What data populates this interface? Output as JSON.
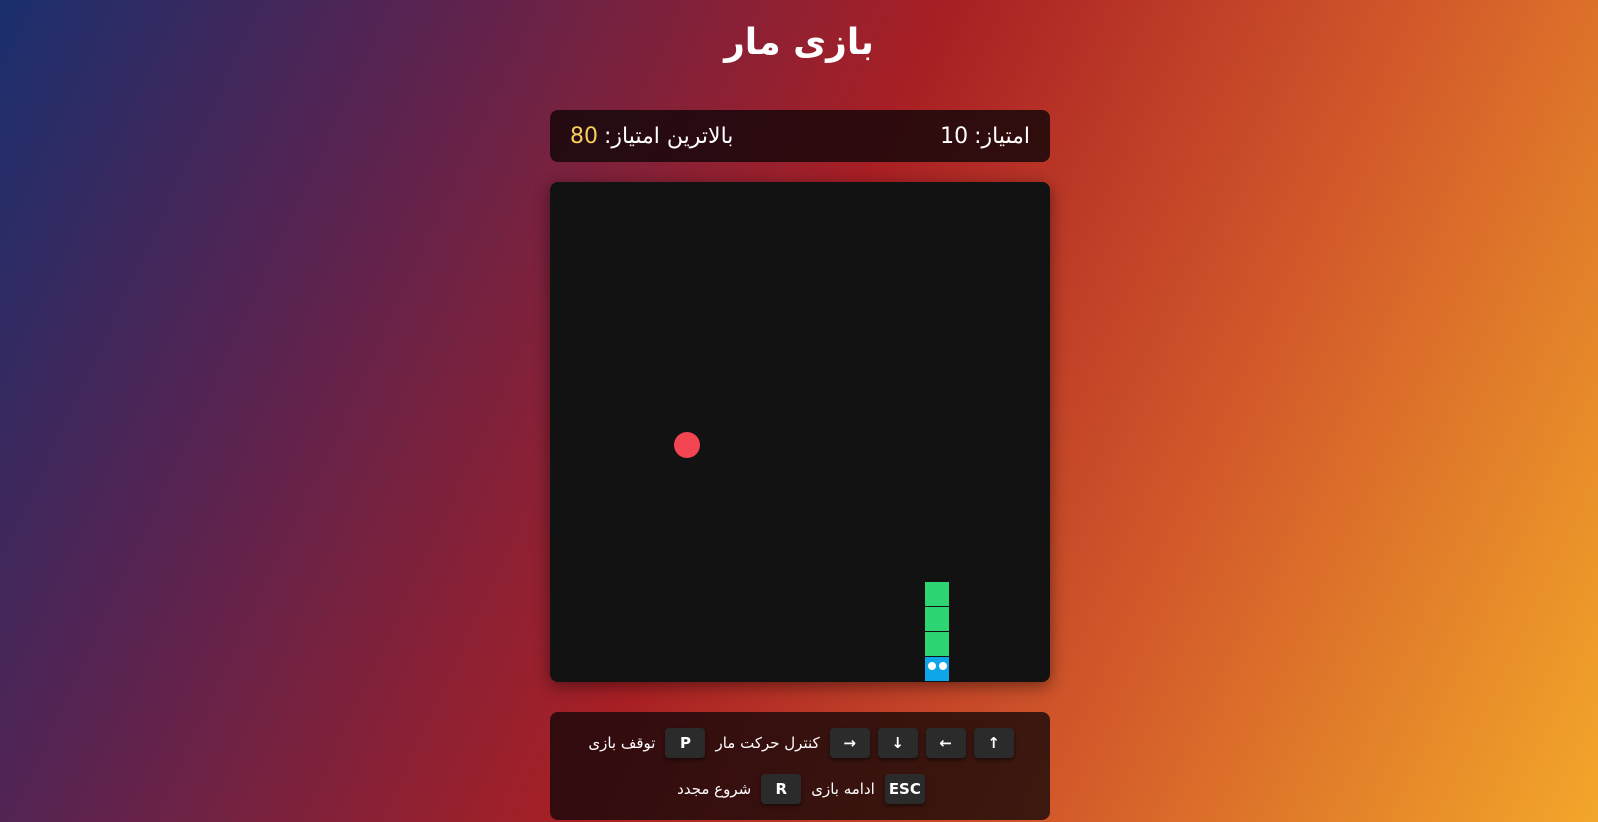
{
  "title": "بازی مار",
  "scorebar": {
    "score_label": "امتیاز:",
    "score_value": "10",
    "highscore_label": "بالاترین امتیاز:",
    "highscore_value": "80"
  },
  "board": {
    "food_color": "#f34452",
    "snake_body_color": "#2ed573",
    "snake_head_color": "#0ea5e9",
    "background_color": "#121212"
  },
  "controls": {
    "row1": {
      "keys_move": [
        "↑",
        "←",
        "↓",
        "→"
      ],
      "move_label": "کنترل حرکت مار",
      "pause_key": "P",
      "pause_label": "توقف بازی"
    },
    "row2": {
      "resume_key": "ESC",
      "resume_label": "ادامه بازی",
      "restart_key": "R",
      "restart_label": "شروع مجدد"
    }
  }
}
